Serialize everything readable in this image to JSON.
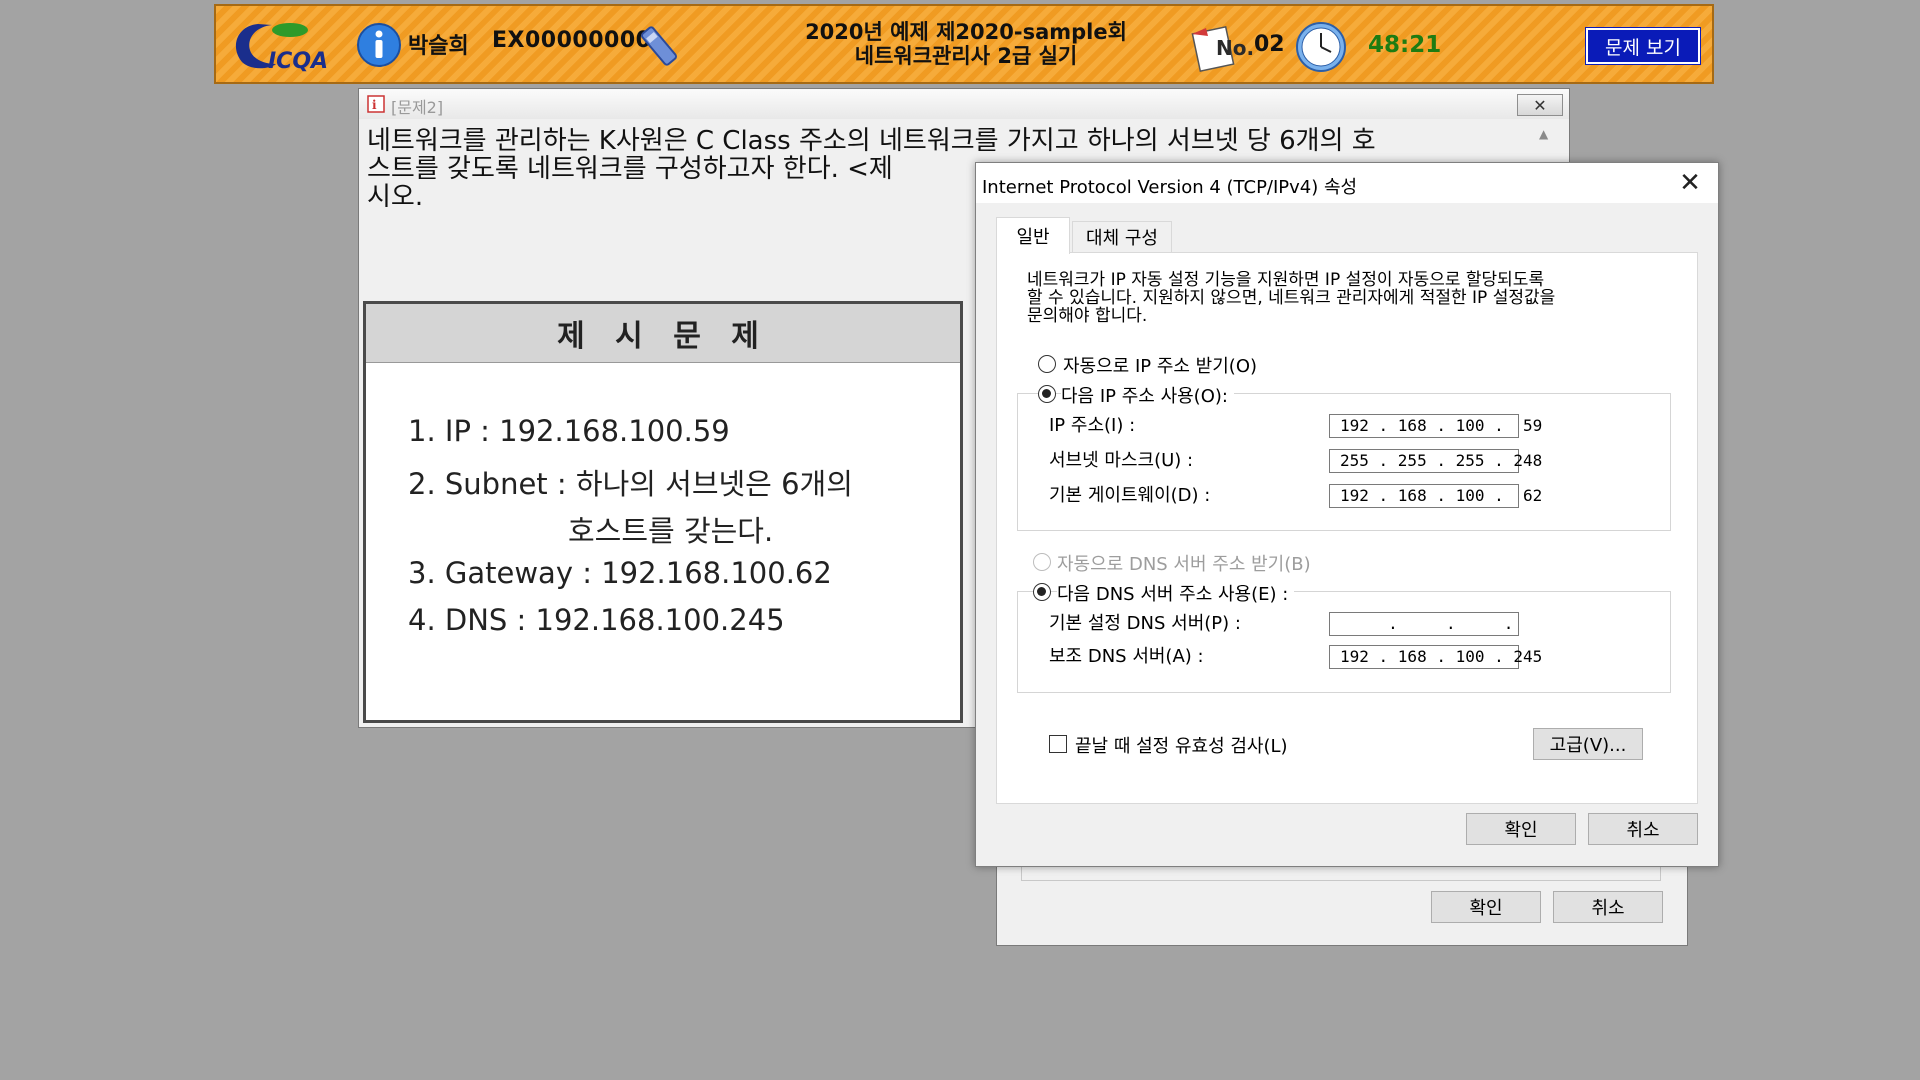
{
  "topbar": {
    "logo_text": "ICQA",
    "user_name": "박슬희",
    "exam_id": "EX00000000",
    "exam_title_line1": "2020년 예제 제2020-sample회",
    "exam_title_line2": "네트워크관리사 2급 실기",
    "no_label": "No.",
    "no_value": "02",
    "timer": "48:21",
    "view_problem_label": "문제 보기",
    "colors": {
      "bar": "#f09b22",
      "button": "#0a1bb8",
      "timer": "#1e7c12"
    }
  },
  "problem_window": {
    "title": "[문제2]",
    "close_glyph": "✕",
    "question_line1": "네트워크를 관리하는 K사원은 C Class 주소의 네트워크를 가지고 하나의 서브넷 당 6개의 호",
    "question_line2": "스트를 갖도록 네트워크를 구성하고자 한다. <제",
    "question_line3": "시오.",
    "presented_heading": "제 시 문 제",
    "items": [
      "1. IP : 192.168.100.59",
      "2. Subnet : 하나의 서브넷은 6개의",
      "호스트를 갖는다.",
      "3. Gateway : 192.168.100.62",
      "4. DNS : 192.168.100.245"
    ]
  },
  "back_dialog": {
    "ok_label": "확인",
    "cancel_label": "취소"
  },
  "tcp_dialog": {
    "title": "Internet Protocol Version 4 (TCP/IPv4) 속성",
    "close_glyph": "✕",
    "tabs": [
      "일반",
      "대체 구성"
    ],
    "description_line1": "네트워크가 IP 자동 설정 기능을 지원하면 IP 설정이 자동으로 할당되도록",
    "description_line2": "할 수 있습니다. 지원하지 않으면, 네트워크 관리자에게 적절한 IP 설정값을",
    "description_line3": "문의해야 합니다.",
    "auto_ip_label": "자동으로 IP 주소 받기(O)",
    "manual_ip_label": "다음 IP 주소 사용(O):",
    "ip_label": "IP 주소(I) :",
    "ip_value": "192 . 168 . 100 .  59",
    "subnet_label": "서브넷 마스크(U) :",
    "subnet_value": "255 . 255 . 255 . 248",
    "gateway_label": "기본 게이트웨이(D) :",
    "gateway_value": "192 . 168 . 100 .  62",
    "auto_dns_label": "자동으로 DNS 서버 주소 받기(B)",
    "manual_dns_label": "다음 DNS 서버 주소 사용(E) :",
    "pref_dns_label": "기본 설정 DNS 서버(P) :",
    "pref_dns_value": "     .     .     .",
    "alt_dns_label": "보조 DNS 서버(A) :",
    "alt_dns_value": "192 . 168 . 100 . 245",
    "validate_label": "끝날 때 설정 유효성 검사(L)",
    "advanced_label": "고급(V)...",
    "ok_label": "확인",
    "cancel_label": "취소"
  }
}
